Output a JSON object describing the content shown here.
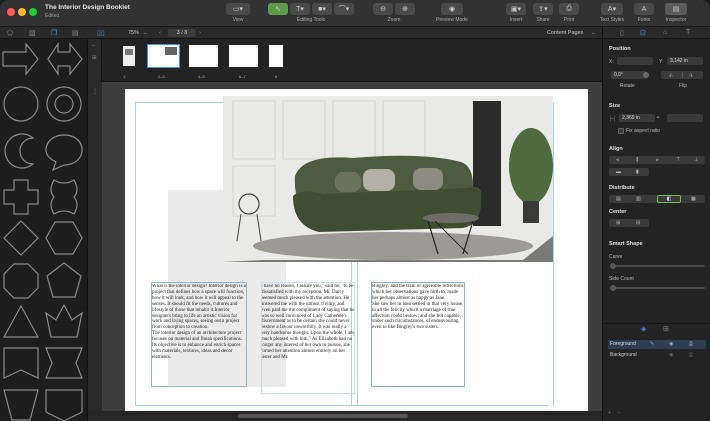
{
  "window": {
    "title": "The Interior Design Booklet",
    "subtitle": "Edited"
  },
  "toolbar": {
    "view_label": "View",
    "editing_tools_label": "Editing Tools",
    "zoom_label": "Zoom",
    "preview_mode_label": "Preview Mode",
    "insert_label": "Insert",
    "share_label": "Share",
    "print_label": "Print",
    "text_styles_label": "Text Styles",
    "fonts_label": "Fonts",
    "inspector_label": "Inspector"
  },
  "canvas_bar": {
    "zoom_value": "75%",
    "page_indicator": "3 / 8",
    "pages_mode": "Content Pages"
  },
  "thumbnails": [
    "1",
    "2–3",
    "4–5",
    "6–7",
    "8"
  ],
  "columns": {
    "col1": "What is the interior design? Interior design is a project that defines how a space will function, how it will look, and how it will appeal to the senses. It should fit the needs, cultures and lifestyle of those that inhabit it.Interior designers bring to life an artistic vision for work and living spaces, seeing out a project from conception to creation.\nThe interior design of an architecture project focuses on material and finish specifications.\nIts objective is to enhance and enrich spaces with materials, textures, ideas and decor elements.",
    "col2": "I have no reason, I assure you,\" said he, \"to be dissatisfied with my reception. Mr. Darcy seemed much pleased with the attention. He answered me with the utmost civility, and even paid me the compliment of saying that he was so well convinced of Lady Catherine's discernment as to be certain she could never bestow a favour unworthily. It was really a very handsome thought. Upon the whole, I am much pleased with him.\" As Elizabeth had no longer any interest of her own to pursue, she turned her attention almost entirely on her sister and Mr.",
    "col3": "Bingley; and the train of agreeable reflections which her observations gave birth to, made her perhaps almost as happy as Jane.\nShe saw her in idea settled in that very house, in all the felicity which a marriage of true affection could bestow; and she felt capable, under such circumstances, of endeavouring even to like Bingley's two sisters."
  },
  "inspector": {
    "position_title": "Position",
    "x_label": "X:",
    "y_label": "Y:",
    "y_value": "3,142 in",
    "rotation_value": "0,0°",
    "rotate_label": "Rotate",
    "flip_label": "Flip",
    "size_title": "Size",
    "width_value": "2,369 in",
    "aspect_label": "Fix aspect ratio",
    "align_title": "Align",
    "distribute_title": "Distribute",
    "center_title": "Center",
    "smart_shape_title": "Smart Shape",
    "curve_label": "Curve",
    "side_count_label": "Side Count",
    "layers": [
      "Foreground",
      "Background"
    ]
  },
  "colors": {
    "accent": "#4a90e2",
    "selected": "#6fbf4a",
    "page_bg": "#ffffff",
    "stage_bg": "#3e3e3e"
  }
}
